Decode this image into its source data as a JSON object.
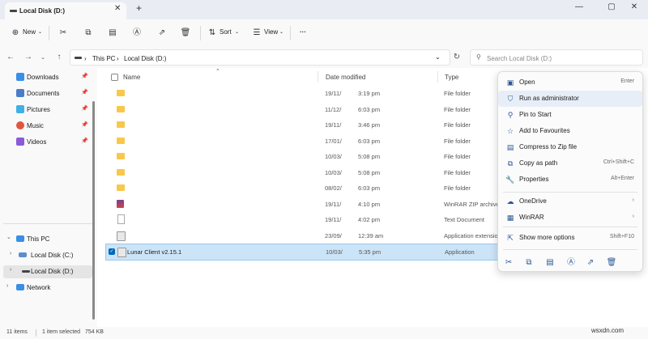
{
  "tab": {
    "title": "Local Disk (D:)",
    "close": "✕",
    "new": "+"
  },
  "window": {
    "minimize": "—",
    "maximize": "▢",
    "close": "✕"
  },
  "toolbar": {
    "new_label": "New",
    "sort_label": "Sort",
    "view_label": "View",
    "more": "···"
  },
  "address": {
    "this_pc": "This PC",
    "sep": "›",
    "current": "Local Disk (D:)",
    "search_placeholder": "Search Local Disk (D:)"
  },
  "sidebar": {
    "quick": [
      {
        "label": "Downloads",
        "color": "#3a8ee6"
      },
      {
        "label": "Documents",
        "color": "#4a7cc7"
      },
      {
        "label": "Pictures",
        "color": "#3db0e8"
      },
      {
        "label": "Music",
        "color": "#e0553d"
      },
      {
        "label": "Videos",
        "color": "#8a5ad8"
      }
    ],
    "tree": [
      {
        "label": "This PC"
      },
      {
        "label": "Local Disk (C:)"
      },
      {
        "label": "Local Disk (D:)"
      },
      {
        "label": "Network"
      }
    ]
  },
  "columns": {
    "name": "Name",
    "date": "Date modified",
    "type": "Type"
  },
  "rows": [
    {
      "name": "",
      "date": "19/11/",
      "time": "3:19 pm",
      "type": "File folder",
      "icon": "folder"
    },
    {
      "name": "",
      "date": "11/12/",
      "time": "6:03 pm",
      "type": "File folder",
      "icon": "folder"
    },
    {
      "name": "",
      "date": "19/11/",
      "time": "3:46 pm",
      "type": "File folder",
      "icon": "folder"
    },
    {
      "name": "",
      "date": "17/01/",
      "time": "6:03 pm",
      "type": "File folder",
      "icon": "folder"
    },
    {
      "name": "",
      "date": "10/03/",
      "time": "5:08 pm",
      "type": "File folder",
      "icon": "folder"
    },
    {
      "name": "",
      "date": "10/03/",
      "time": "5:08 pm",
      "type": "File folder",
      "icon": "folder"
    },
    {
      "name": "",
      "date": "08/02/",
      "time": "6:03 pm",
      "type": "File folder",
      "icon": "folder"
    },
    {
      "name": "",
      "date": "19/11/",
      "time": "4:10 pm",
      "type": "WinRAR ZIP archive",
      "icon": "winrar"
    },
    {
      "name": "",
      "date": "19/11/",
      "time": "4:02 pm",
      "type": "Text Document",
      "icon": "text"
    },
    {
      "name": "",
      "date": "23/09/",
      "time": "12:39 am",
      "type": "Application extensio",
      "icon": "app"
    },
    {
      "name": "Lunar Client v2.15.1",
      "date": "10/03/",
      "time": "5:35 pm",
      "type": "Application",
      "icon": "app",
      "selected": true
    }
  ],
  "context_menu": [
    {
      "label": "Open",
      "shortcut": "Enter",
      "icon": "▣"
    },
    {
      "label": "Run as administrator",
      "shortcut": "",
      "icon": "⛉"
    },
    {
      "label": "Pin to Start",
      "shortcut": "",
      "icon": "⚲"
    },
    {
      "label": "Add to Favourites",
      "shortcut": "",
      "icon": "☆"
    },
    {
      "label": "Compress to Zip file",
      "shortcut": "",
      "icon": "▤"
    },
    {
      "label": "Copy as path",
      "shortcut": "Ctrl+Shift+C",
      "icon": "⧉"
    },
    {
      "label": "Properties",
      "shortcut": "Alt+Enter",
      "icon": "🔧"
    },
    {
      "label": "OneDrive",
      "shortcut": "›",
      "icon": "☁"
    },
    {
      "label": "WinRAR",
      "shortcut": "›",
      "icon": "▦"
    },
    {
      "label": "Show more options",
      "shortcut": "Shift+F10",
      "icon": "⇱"
    }
  ],
  "status": {
    "items": "11 items",
    "selected": "1 item selected",
    "size": "754 KB"
  },
  "watermark": "wsxdn.com",
  "colors": {
    "accent": "#0067c0",
    "selection": "#cce4f7",
    "folder": "#f8c84b"
  }
}
